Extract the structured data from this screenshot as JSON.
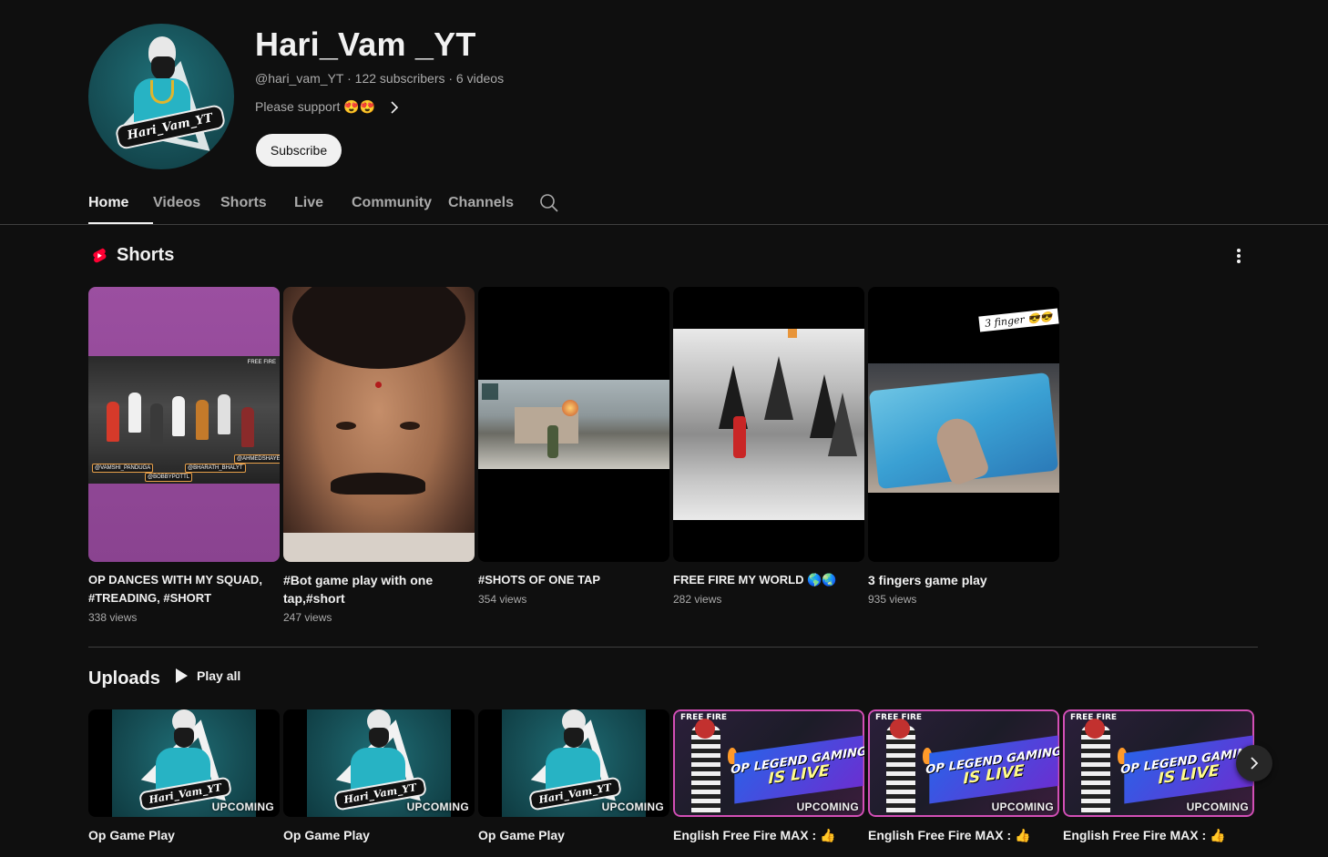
{
  "channel": {
    "name": "Hari_Vam _YT",
    "meta": "@hari_vam_YT · 122 subscribers · 6 videos",
    "description": "Please support 😍😍",
    "subscribe_label": "Subscribe",
    "avatar_text": "Hari_Vam_YT"
  },
  "tabs": [
    {
      "label": "Home",
      "active": true
    },
    {
      "label": "Videos",
      "active": false
    },
    {
      "label": "Shorts",
      "active": false
    },
    {
      "label": "Live",
      "active": false
    },
    {
      "label": "Community",
      "active": false
    },
    {
      "label": "Channels",
      "active": false
    }
  ],
  "shorts": {
    "title": "Shorts",
    "items": [
      {
        "title": "OP DANCES WITH MY SQUAD, #TREADING, #SHORT",
        "views": "338 views"
      },
      {
        "title": "#Bot game play with one tap,#short",
        "views": "247 views"
      },
      {
        "title": "#SHOTS OF ONE TAP",
        "views": "354 views"
      },
      {
        "title": "FREE FIRE MY WORLD 🌎🌏",
        "views": "282 views"
      },
      {
        "title": "3 fingers game play",
        "views": "935 views",
        "thumb_caption": "3 finger 😎😎"
      }
    ],
    "thumb1_labels": [
      "@VAMSHI_PANDUGA",
      "@BHARATH_BHALYT",
      "@BOBBYPOTTL",
      "@AHMEDSHAYER",
      "FREE FIRE"
    ]
  },
  "uploads": {
    "title": "Uploads",
    "play_all_label": "Play all",
    "items": [
      {
        "title": "Op Game Play",
        "badge": "UPCOMING",
        "thumb_text": "Hari_Vam_YT"
      },
      {
        "title": "Op Game Play",
        "badge": "UPCOMING",
        "thumb_text": "Hari_Vam_YT"
      },
      {
        "title": "Op Game Play",
        "badge": "UPCOMING",
        "thumb_text": "Hari_Vam_YT"
      },
      {
        "title": "English Free Fire MAX : 👍",
        "badge": "UPCOMING",
        "banner_l1": "OP LEGEND GAMING",
        "banner_l2": "IS LIVE",
        "ff": "FREE FIRE"
      },
      {
        "title": "English Free Fire MAX : 👍",
        "badge": "UPCOMING",
        "banner_l1": "OP LEGEND GAMING",
        "banner_l2": "IS LIVE",
        "ff": "FREE FIRE"
      },
      {
        "title": "English Free Fire MAX : 👍",
        "badge": "UPCOMING",
        "banner_l1": "OP LEGEND GAMING",
        "banner_l2": "IS LIVE",
        "ff": "FREE FIRE"
      }
    ]
  },
  "icons": {
    "search": "search-icon",
    "shorts": "shorts-icon",
    "more": "more-vert-icon",
    "play": "play-icon",
    "next": "chevron-right-icon",
    "description_chevron": "chevron-right-icon"
  },
  "colors": {
    "background": "#0f0f0f",
    "text_primary": "#f1f1f1",
    "text_secondary": "#aaaaaa",
    "shorts_red": "#ff0033",
    "divider": "#3f3f3f"
  }
}
